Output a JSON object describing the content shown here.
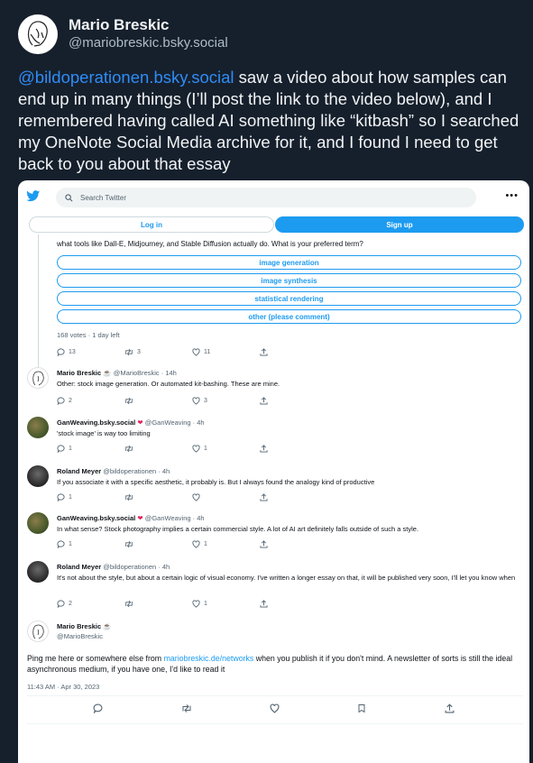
{
  "post": {
    "author_name": "Mario Breskic",
    "author_handle": "@mariobreskic.bsky.social",
    "mention": "@bildoperationen.bsky.social",
    "text": " saw a video about how samples can end up in many things (I’ll post the link to the video below), and I remembered having called AI something like “kitbash” so I searched my OneNote Social Media archive for it, and I found I need to get back to you about that essay"
  },
  "screenshot": {
    "search_placeholder": "Search Twitter",
    "more_label": "•••",
    "login_label": "Log in",
    "signup_label": "Sign up",
    "poll": {
      "question": "what tools like Dall-E, Midjourney, and Stable Diffusion actually do. What is your preferred term?",
      "options": [
        "image generation",
        "image synthesis",
        "statistical rendering",
        "other (please comment)"
      ],
      "meta": "168 votes · 1 day left",
      "replies": "13",
      "retweets": "3",
      "likes": "11"
    },
    "replies": [
      {
        "name": "Mario Breskic",
        "meta": "@MarioBreskic · 14h",
        "text": "Other: stock image generation. Or automated kit-bashing. These are mine.",
        "replies": "2",
        "retweets": "",
        "likes": "3"
      },
      {
        "name": "GanWeaving.bsky.social",
        "meta": "@GanWeaving · 4h",
        "text": "'stock image' is way too limiting",
        "replies": "1",
        "retweets": "",
        "likes": "1"
      },
      {
        "name": "Roland Meyer",
        "meta": "@bildoperationen · 4h",
        "text": "If you associate it with a specific aesthetic, it probably is. But I always found the analogy kind of productive",
        "replies": "1",
        "retweets": "",
        "likes": ""
      },
      {
        "name": "GanWeaving.bsky.social",
        "meta": "@GanWeaving · 4h",
        "text": "In what sense? Stock photography implies a certain commercial style. A lot of AI art definitely falls outside of such a style.",
        "replies": "1",
        "retweets": "",
        "likes": "1"
      },
      {
        "name": "Roland Meyer",
        "meta": "@bildoperationen · 4h",
        "text": "It's not about the style, but about a certain logic of visual economy. I've written a longer essay on that, it will be published very soon, I'll let you know when",
        "replies": "2",
        "retweets": "",
        "likes": "1"
      }
    ],
    "main_tweet": {
      "name": "Mario Breskic",
      "handle": "@MarioBreskic",
      "text_before": "Ping me here or somewhere else from ",
      "link": "mariobreskic.de/networks",
      "text_after": " when you publish it if you don't mind.  A newsletter of sorts is still the ideal asynchronous medium, if you have one, I'd like to read it",
      "time": "11:43 AM · Apr 30, 2023"
    }
  },
  "colors": {
    "background": "#16202c",
    "twitter_blue": "#1d9bf0",
    "link": "#2f8cf7"
  },
  "icons": [
    "sketch-avatar-icon",
    "twitter-bird-icon",
    "search-icon",
    "reply-icon",
    "retweet-icon",
    "like-icon",
    "share-icon",
    "bookmark-icon",
    "heart-emoji-icon",
    "cup-emoji-icon"
  ]
}
